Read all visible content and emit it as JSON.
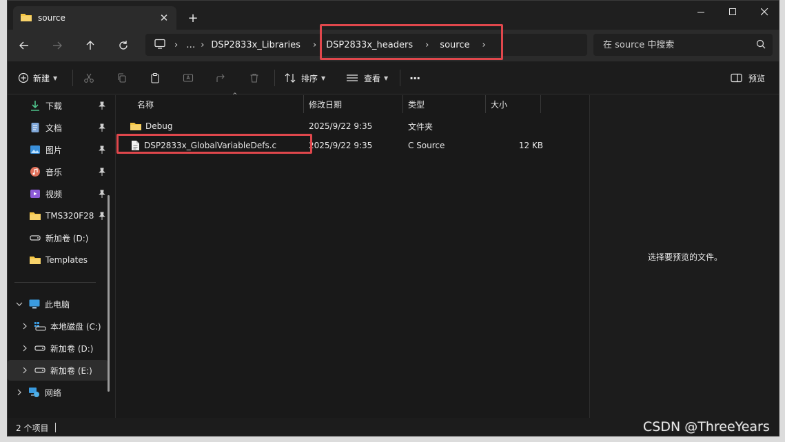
{
  "window": {
    "tab_title": "source",
    "tab_close": "✕",
    "new_tab": "+"
  },
  "nav": {
    "breadcrumbs": [
      "…",
      "DSP2833x_Libraries",
      "DSP2833x_headers",
      "source"
    ],
    "search_placeholder": "在 source 中搜索"
  },
  "toolbar": {
    "new_label": "新建",
    "sort_label": "排序",
    "view_label": "查看",
    "more_label": "···",
    "preview_label": "预览"
  },
  "sidebar": {
    "quick": [
      {
        "label": "下载",
        "icon": "download-icon"
      },
      {
        "label": "文档",
        "icon": "document-icon"
      },
      {
        "label": "图片",
        "icon": "pictures-icon"
      },
      {
        "label": "音乐",
        "icon": "music-icon"
      },
      {
        "label": "视频",
        "icon": "video-icon"
      },
      {
        "label": "TMS320F28",
        "icon": "folder-icon"
      },
      {
        "label": "新加卷 (D:)",
        "icon": "drive-icon"
      },
      {
        "label": "Templates",
        "icon": "folder-icon"
      }
    ],
    "this_pc": "此电脑",
    "drives": [
      "本地磁盘 (C:)",
      "新加卷 (D:)",
      "新加卷 (E:)"
    ],
    "network": "网络"
  },
  "columns": [
    "名称",
    "修改日期",
    "类型",
    "大小"
  ],
  "files": [
    {
      "name": "Debug",
      "date": "2025/9/22 9:35",
      "type": "文件夹",
      "size": ""
    },
    {
      "name": "DSP2833x_GlobalVariableDefs.c",
      "date": "2025/9/22 9:35",
      "type": "C Source",
      "size": "12 KB"
    }
  ],
  "preview": {
    "message": "选择要预览的文件。"
  },
  "status": {
    "item_count": "2 个项目"
  },
  "watermark": "CSDN @ThreeYears",
  "colors": {
    "highlight": "#e0474c",
    "folder": "#f4c542",
    "background": "#191919"
  }
}
